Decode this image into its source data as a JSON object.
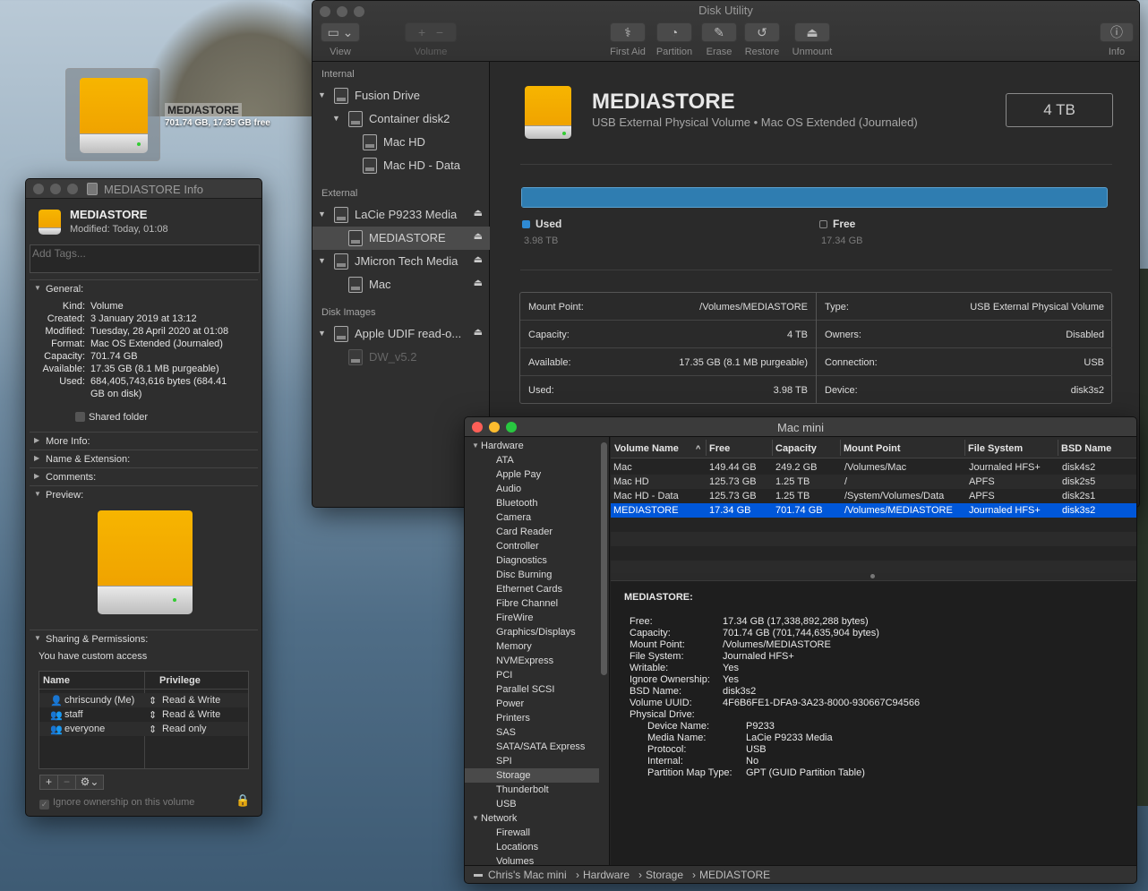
{
  "desktop": {
    "drive_name": "MEDIASTORE",
    "drive_stats": "701.74 GB, 17.35 GB free"
  },
  "disk_utility": {
    "title": "Disk Utility",
    "toolbar": {
      "view": "View",
      "add": "+",
      "remove": "−",
      "volume": "Volume",
      "first_aid": "First Aid",
      "partition": "Partition",
      "erase": "Erase",
      "restore": "Restore",
      "unmount": "Unmount",
      "info": "Info"
    },
    "sidebar": {
      "internal": "Internal",
      "external": "External",
      "disk_images": "Disk Images",
      "items": [
        {
          "label": "Fusion Drive"
        },
        {
          "label": "Container disk2"
        },
        {
          "label": "Mac HD"
        },
        {
          "label": "Mac HD - Data"
        },
        {
          "label": "LaCie P9233 Media"
        },
        {
          "label": "MEDIASTORE"
        },
        {
          "label": "JMicron Tech Media"
        },
        {
          "label": "Mac"
        },
        {
          "label": "Apple UDIF read-o..."
        },
        {
          "label": "DW_v5.2"
        }
      ]
    },
    "volume": {
      "name": "MEDIASTORE",
      "subtitle": "USB External Physical Volume • Mac OS Extended (Journaled)",
      "size": "4 TB",
      "used_fraction": 0.9957,
      "used_label": "Used",
      "used_value": "3.98 TB",
      "free_label": "Free",
      "free_value": "17.34 GB"
    },
    "info_table": {
      "left": [
        {
          "k": "Mount Point:",
          "v": "/Volumes/MEDIASTORE"
        },
        {
          "k": "Capacity:",
          "v": "4 TB"
        },
        {
          "k": "Available:",
          "v": "17.35 GB (8.1 MB purgeable)"
        },
        {
          "k": "Used:",
          "v": "3.98 TB"
        }
      ],
      "right": [
        {
          "k": "Type:",
          "v": "USB External Physical Volume"
        },
        {
          "k": "Owners:",
          "v": "Disabled"
        },
        {
          "k": "Connection:",
          "v": "USB"
        },
        {
          "k": "Device:",
          "v": "disk3s2"
        }
      ]
    }
  },
  "info_window": {
    "title": "MEDIASTORE Info",
    "name": "MEDIASTORE",
    "modified": "Modified: Today, 01:08",
    "tags_placeholder": "Add Tags...",
    "general": "General:",
    "general_rows": [
      {
        "k": "Kind:",
        "v": "Volume"
      },
      {
        "k": "Created:",
        "v": "3 January 2019 at 13:12"
      },
      {
        "k": "Modified:",
        "v": "Tuesday, 28 April 2020 at 01:08"
      },
      {
        "k": "Format:",
        "v": "Mac OS Extended (Journaled)"
      },
      {
        "k": "Capacity:",
        "v": "701.74 GB"
      },
      {
        "k": "Available:",
        "v": "17.35 GB (8.1 MB purgeable)"
      },
      {
        "k": "Used:",
        "v": "684,405,743,616 bytes (684.41"
      },
      {
        "k": "",
        "v": "GB on disk)"
      }
    ],
    "shared_folder": "Shared folder",
    "more_info": "More Info:",
    "name_ext": "Name & Extension:",
    "comments": "Comments:",
    "preview": "Preview:",
    "sharing": "Sharing & Permissions:",
    "access": "You have custom access",
    "perm_head": {
      "name": "Name",
      "priv": "Privilege"
    },
    "perms": [
      {
        "name": "chriscundy (Me)",
        "priv": "Read & Write"
      },
      {
        "name": "staff",
        "priv": "Read & Write"
      },
      {
        "name": "everyone",
        "priv": "Read only"
      }
    ],
    "ignore": "Ignore ownership on this volume"
  },
  "sysinfo": {
    "title": "Mac mini",
    "tree": [
      {
        "label": "Hardware",
        "group": true
      },
      {
        "label": "ATA"
      },
      {
        "label": "Apple Pay"
      },
      {
        "label": "Audio"
      },
      {
        "label": "Bluetooth"
      },
      {
        "label": "Camera"
      },
      {
        "label": "Card Reader"
      },
      {
        "label": "Controller"
      },
      {
        "label": "Diagnostics"
      },
      {
        "label": "Disc Burning"
      },
      {
        "label": "Ethernet Cards"
      },
      {
        "label": "Fibre Channel"
      },
      {
        "label": "FireWire"
      },
      {
        "label": "Graphics/Displays"
      },
      {
        "label": "Memory"
      },
      {
        "label": "NVMExpress"
      },
      {
        "label": "PCI"
      },
      {
        "label": "Parallel SCSI"
      },
      {
        "label": "Power"
      },
      {
        "label": "Printers"
      },
      {
        "label": "SAS"
      },
      {
        "label": "SATA/SATA Express"
      },
      {
        "label": "SPI"
      },
      {
        "label": "Storage"
      },
      {
        "label": "Thunderbolt"
      },
      {
        "label": "USB"
      },
      {
        "label": "Network",
        "group": true
      },
      {
        "label": "Firewall"
      },
      {
        "label": "Locations"
      },
      {
        "label": "Volumes"
      }
    ],
    "columns": [
      "Volume Name",
      "Free",
      "Capacity",
      "Mount Point",
      "File System",
      "BSD Name"
    ],
    "rows": [
      [
        "Mac",
        "149.44 GB",
        "249.2 GB",
        "/Volumes/Mac",
        "Journaled HFS+",
        "disk4s2"
      ],
      [
        "Mac HD",
        "125.73 GB",
        "1.25 TB",
        "/",
        "APFS",
        "disk2s5"
      ],
      [
        "Mac HD - Data",
        "125.73 GB",
        "1.25 TB",
        "/System/Volumes/Data",
        "APFS",
        "disk2s1"
      ],
      [
        "MEDIASTORE",
        "17.34 GB",
        "701.74 GB",
        "/Volumes/MEDIASTORE",
        "Journaled HFS+",
        "disk3s2"
      ]
    ],
    "detail_title": "MEDIASTORE:",
    "detail": [
      {
        "k": "Free:",
        "v": "17.34 GB (17,338,892,288 bytes)"
      },
      {
        "k": "Capacity:",
        "v": "701.74 GB (701,744,635,904 bytes)"
      },
      {
        "k": "Mount Point:",
        "v": "/Volumes/MEDIASTORE"
      },
      {
        "k": "File System:",
        "v": "Journaled HFS+"
      },
      {
        "k": "Writable:",
        "v": "Yes"
      },
      {
        "k": "Ignore Ownership:",
        "v": "Yes"
      },
      {
        "k": "BSD Name:",
        "v": "disk3s2"
      },
      {
        "k": "Volume UUID:",
        "v": "4F6B6FE1-DFA9-3A23-8000-930667C94566"
      },
      {
        "k": "Physical Drive:",
        "v": ""
      }
    ],
    "physical": [
      {
        "k": "Device Name:",
        "v": "P9233"
      },
      {
        "k": "Media Name:",
        "v": "LaCie P9233 Media"
      },
      {
        "k": "Protocol:",
        "v": "USB"
      },
      {
        "k": "Internal:",
        "v": "No"
      },
      {
        "k": "Partition Map Type:",
        "v": "GPT (GUID Partition Table)"
      }
    ],
    "path": [
      "Chris's Mac mini",
      "Hardware",
      "Storage",
      "MEDIASTORE"
    ]
  }
}
